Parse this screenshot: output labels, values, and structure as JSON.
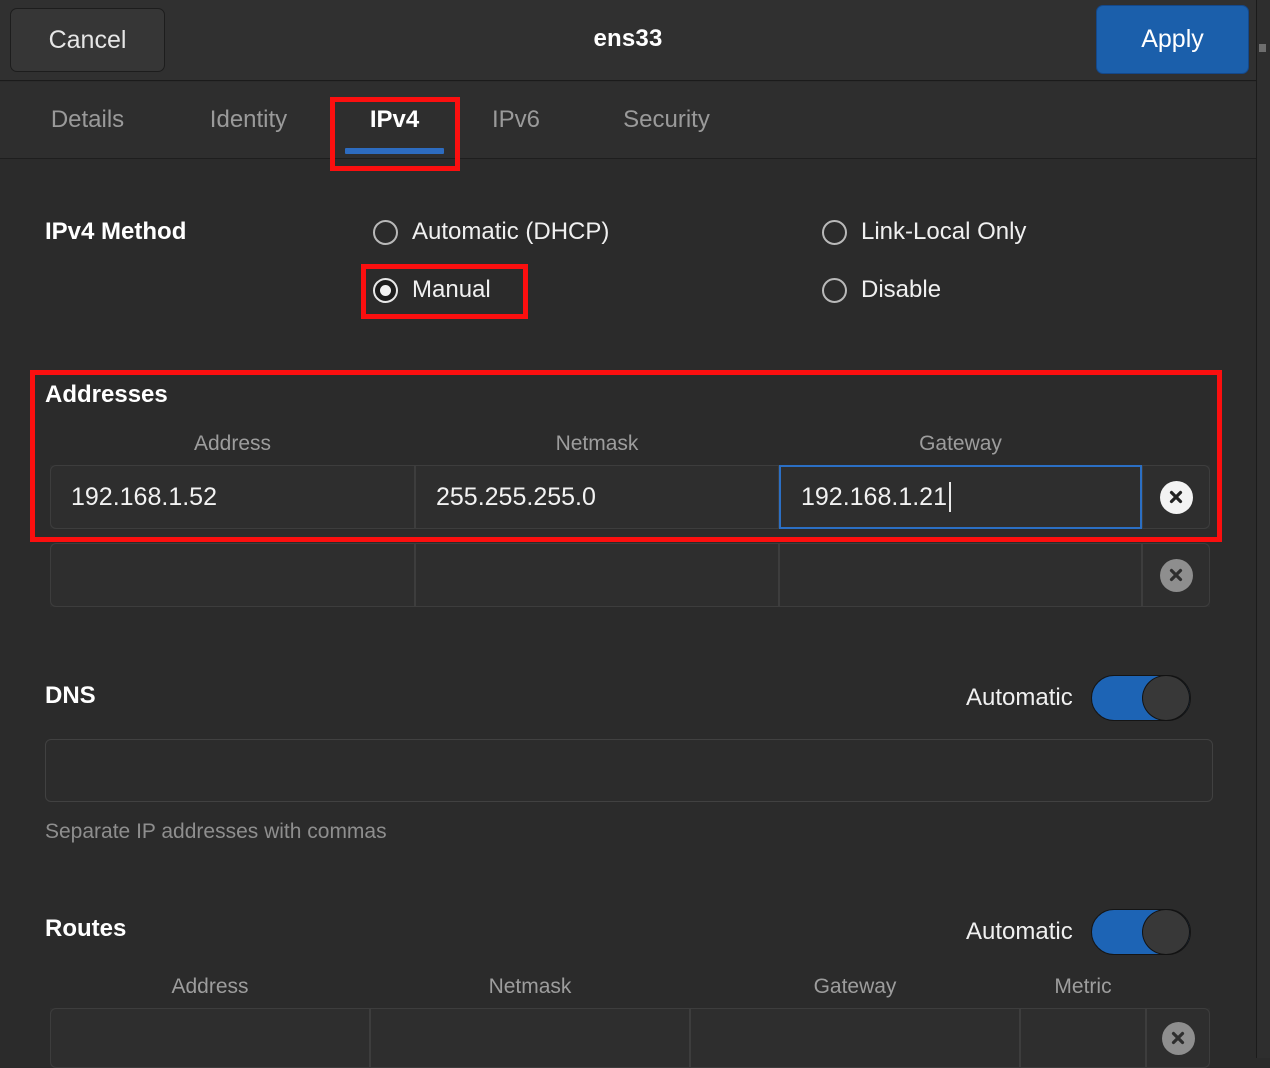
{
  "window": {
    "title": "ens33",
    "cancel_label": "Cancel",
    "apply_label": "Apply"
  },
  "tabs": [
    {
      "label": "Details",
      "active": false
    },
    {
      "label": "Identity",
      "active": false
    },
    {
      "label": "IPv4",
      "active": true
    },
    {
      "label": "IPv6",
      "active": false
    },
    {
      "label": "Security",
      "active": false
    }
  ],
  "ipv4_method": {
    "label": "IPv4 Method",
    "options": [
      {
        "label": "Automatic (DHCP)",
        "selected": false
      },
      {
        "label": "Manual",
        "selected": true
      },
      {
        "label": "Link-Local Only",
        "selected": false
      },
      {
        "label": "Disable",
        "selected": false
      }
    ]
  },
  "addresses": {
    "title": "Addresses",
    "columns": [
      "Address",
      "Netmask",
      "Gateway"
    ],
    "rows": [
      {
        "address": "192.168.1.52",
        "netmask": "255.255.255.0",
        "gateway": "192.168.1.21",
        "focused_field": "gateway"
      },
      {
        "address": "",
        "netmask": "",
        "gateway": "",
        "focused_field": ""
      }
    ]
  },
  "dns": {
    "title": "DNS",
    "toggle_label": "Automatic",
    "toggle_on": true,
    "value": "",
    "placeholder": "",
    "hint": "Separate IP addresses with commas"
  },
  "routes": {
    "title": "Routes",
    "toggle_label": "Automatic",
    "toggle_on": true,
    "columns": [
      "Address",
      "Netmask",
      "Gateway",
      "Metric"
    ],
    "rows": [
      {
        "address": "",
        "netmask": "",
        "gateway": "",
        "metric": ""
      }
    ]
  },
  "annotations": {
    "accent_blue": "#2d6cc0",
    "highlight_red": "#fb0f0f",
    "boxes": [
      "ipv4-tab",
      "manual-radio",
      "addresses-section"
    ]
  }
}
